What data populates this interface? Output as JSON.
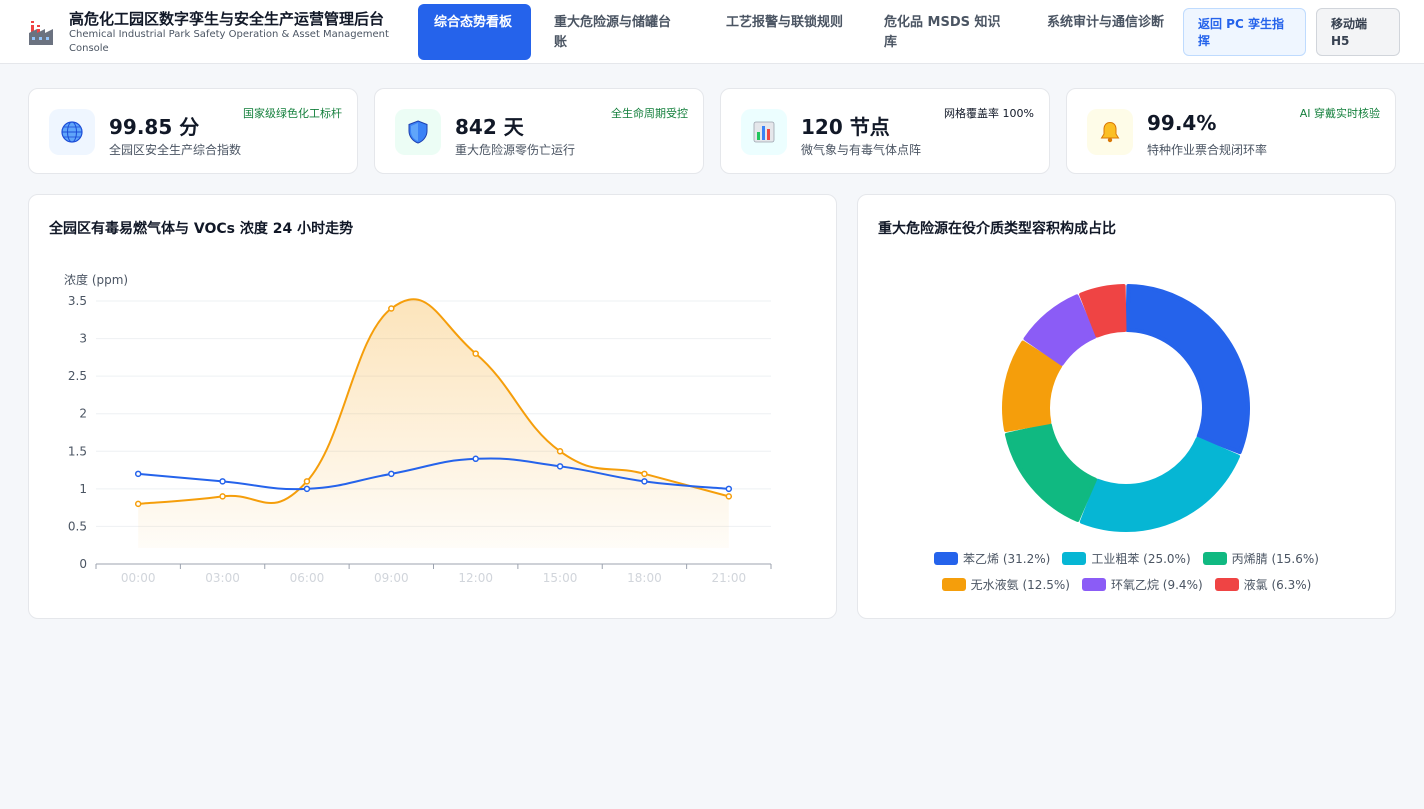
{
  "header": {
    "title": "高危化工园区数字孪生与安全生产运营管理后台",
    "subtitle": "Chemical Industrial Park Safety Operation & Asset Management Console",
    "logo_icon": "factory-icon"
  },
  "nav": [
    {
      "label": "综合态势看板",
      "active": true
    },
    {
      "label": "重大危险源与储罐台账",
      "active": false
    },
    {
      "label": "工艺报警与联锁规则",
      "active": false
    },
    {
      "label": "危化品 MSDS 知识库",
      "active": false
    },
    {
      "label": "系统审计与通信诊断",
      "active": false
    }
  ],
  "header_buttons": {
    "pc": "返回 PC 孪生指挥",
    "mobile": "移动端 H5"
  },
  "kpis": [
    {
      "value": "99.85 分",
      "label": "全园区安全生产综合指数",
      "tag": "国家级绿色化工标杆",
      "icon": "globe-icon",
      "icon_bg": "#eff6ff",
      "tag_color": "#15803d"
    },
    {
      "value": "842 天",
      "label": "重大危险源零伤亡运行",
      "tag": "全生命周期受控",
      "icon": "shield-icon",
      "icon_bg": "#ecfdf5",
      "tag_color": "#15803d"
    },
    {
      "value": "120 节点",
      "label": "微气象与有毒气体点阵",
      "tag": "网格覆盖率 100%",
      "icon": "bar-chart-icon",
      "icon_bg": "#ecfeff",
      "tag_color": "#111827"
    },
    {
      "value": "99.4%",
      "label": "特种作业票合规闭环率",
      "tag": "AI 穿戴实时核验",
      "icon": "bell-icon",
      "icon_bg": "#fefce8",
      "tag_color": "#15803d"
    }
  ],
  "line_panel": {
    "title": "全园区有毒易燃气体与 VOCs 浓度 24 小时走势"
  },
  "donut_panel": {
    "title": "重大危险源在役介质类型容积构成占比"
  },
  "chart_data": [
    {
      "type": "line",
      "ylabel": "浓度 (ppm)",
      "xlabel": "",
      "categories": [
        "00:00",
        "03:00",
        "06:00",
        "09:00",
        "12:00",
        "15:00",
        "18:00",
        "21:00"
      ],
      "ylim": [
        0,
        3.5
      ],
      "yticks": [
        0,
        0.5,
        1,
        1.5,
        2,
        2.5,
        3,
        3.5
      ],
      "grid": true,
      "series": [
        {
          "values": [
            1.2,
            1.1,
            1.0,
            1.2,
            1.4,
            1.3,
            1.1,
            1.0
          ],
          "color": "#2563eb"
        },
        {
          "values": [
            0.8,
            0.9,
            1.1,
            3.4,
            2.8,
            1.5,
            1.2,
            0.9
          ],
          "color": "#f59e0b",
          "area": true
        }
      ]
    },
    {
      "type": "pie",
      "donut": true,
      "legend_position": "bottom",
      "slices": [
        {
          "label": "苯乙烯 (31.2%)",
          "value": 31.2,
          "color": "#2563eb"
        },
        {
          "label": "工业粗苯 (25.0%)",
          "value": 25.0,
          "color": "#06b6d4"
        },
        {
          "label": "丙烯腈 (15.6%)",
          "value": 15.6,
          "color": "#10b981"
        },
        {
          "label": "无水液氨 (12.5%)",
          "value": 12.5,
          "color": "#f59e0b"
        },
        {
          "label": "环氧乙烷 (9.4%)",
          "value": 9.4,
          "color": "#8b5cf6"
        },
        {
          "label": "液氯 (6.3%)",
          "value": 6.3,
          "color": "#ef4444"
        }
      ]
    }
  ]
}
